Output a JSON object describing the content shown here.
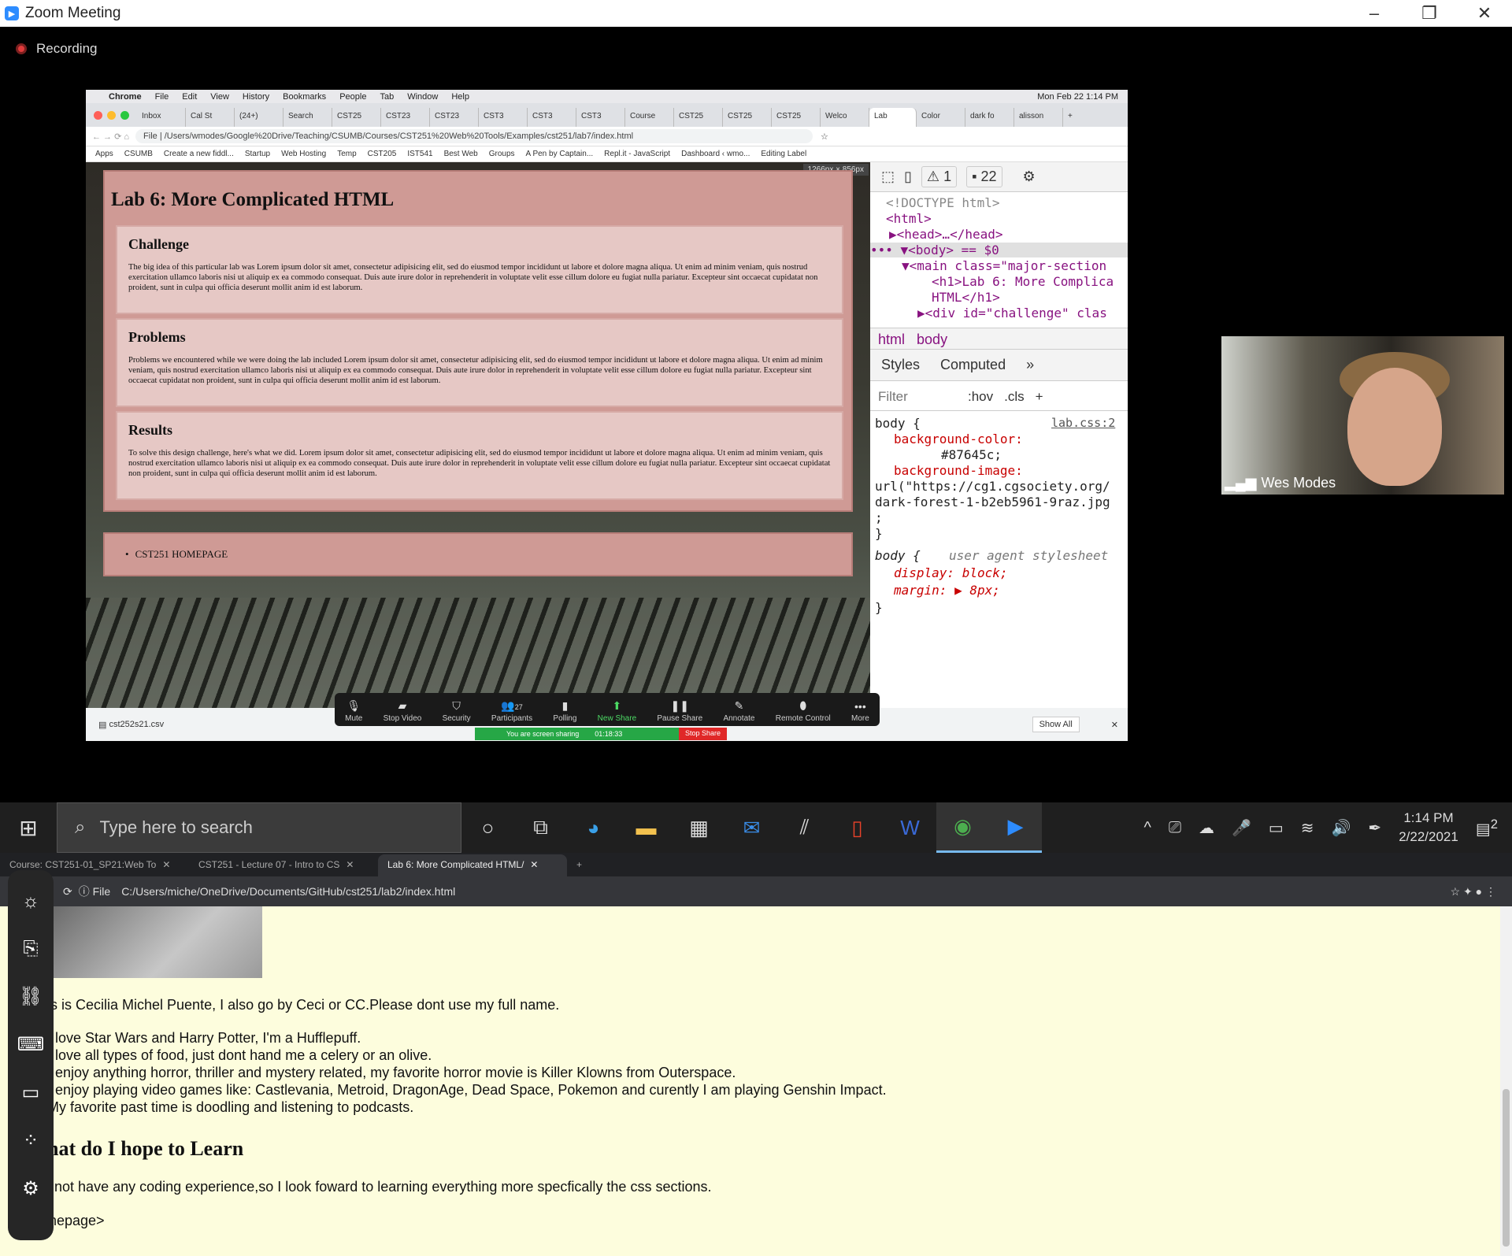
{
  "zoom": {
    "window_title": "Zoom Meeting",
    "recording_label": "Recording",
    "participant_name": "Wes Modes",
    "controls": [
      {
        "label": "Mute",
        "icon": "microphone-icon"
      },
      {
        "label": "Stop Video",
        "icon": "video-camera-icon"
      },
      {
        "label": "Security",
        "icon": "shield-icon"
      },
      {
        "label": "Participants",
        "icon": "participants-icon",
        "count": "27"
      },
      {
        "label": "Polling",
        "icon": "bar-chart-icon"
      },
      {
        "label": "New Share",
        "icon": "share-arrow-icon"
      },
      {
        "label": "Pause Share",
        "icon": "pause-icon"
      },
      {
        "label": "Annotate",
        "icon": "pencil-icon"
      },
      {
        "label": "Remote Control",
        "icon": "mouse-icon"
      },
      {
        "label": "More",
        "icon": "ellipsis-icon"
      }
    ],
    "sharing_text": "You are screen sharing",
    "sharing_time": "01:18:33",
    "stop_share": "Stop Share"
  },
  "mac": {
    "menubar": {
      "app": "Chrome",
      "items": [
        "File",
        "Edit",
        "View",
        "History",
        "Bookmarks",
        "People",
        "Tab",
        "Window",
        "Help"
      ],
      "datetime": "Mon Feb 22  1:14 PM"
    },
    "tabs": [
      "Inbox",
      "Cal St",
      "(24+)",
      "Search",
      "CST25",
      "CST23",
      "CST23",
      "CST3",
      "CST3",
      "CST3",
      "Course",
      "CST25",
      "CST25",
      "CST25",
      "Welco",
      "Lab",
      "Color",
      "dark fo",
      "alisson"
    ],
    "url": "/Users/wmodes/Google%20Drive/Teaching/CSUMB/Courses/CST251%20Web%20Tools/Examples/cst251/lab7/index.html",
    "url_scheme": "File",
    "bookmarks": [
      "Apps",
      "CSUMB",
      "Create a new fiddl...",
      "Startup",
      "Web Hosting",
      "Temp",
      "CST205",
      "IST541",
      "Best Web",
      "Groups",
      "A Pen by Captain...",
      "Repl.it - JavaScript",
      "Dashboard ‹ wmo...",
      "Editing Label"
    ],
    "viewport_size": "1266px × 856px",
    "lab_page": {
      "title": "Lab 6: More Complicated HTML",
      "sections": [
        {
          "heading": "Challenge",
          "text": "The big idea of this particular lab was Lorem ipsum dolor sit amet, consectetur adipisicing elit, sed do eiusmod tempor incididunt ut labore et dolore magna aliqua. Ut enim ad minim veniam, quis nostrud exercitation ullamco laboris nisi ut aliquip ex ea commodo consequat. Duis aute irure dolor in reprehenderit in voluptate velit esse cillum dolore eu fugiat nulla pariatur. Excepteur sint occaecat cupidatat non proident, sunt in culpa qui officia deserunt mollit anim id est laborum."
        },
        {
          "heading": "Problems",
          "text": "Problems we encountered while we were doing the lab included Lorem ipsum dolor sit amet, consectetur adipisicing elit, sed do eiusmod tempor incididunt ut labore et dolore magna aliqua. Ut enim ad minim veniam, quis nostrud exercitation ullamco laboris nisi ut aliquip ex ea commodo consequat. Duis aute irure dolor in reprehenderit in voluptate velit esse cillum dolore eu fugiat nulla pariatur. Excepteur sint occaecat cupidatat non proident, sunt in culpa qui officia deserunt mollit anim id est laborum."
        },
        {
          "heading": "Results",
          "text": "To solve this design challenge, here's what we did. Lorem ipsum dolor sit amet, consectetur adipisicing elit, sed do eiusmod tempor incididunt ut labore et dolore magna aliqua. Ut enim ad minim veniam, quis nostrud exercitation ullamco laboris nisi ut aliquip ex ea commodo consequat. Duis aute irure dolor in reprehenderit in voluptate velit esse cillum dolore eu fugiat nulla pariatur. Excepteur sint occaecat cupidatat non proident, sunt in culpa qui officia deserunt mollit anim id est laborum."
        }
      ],
      "nav_item": "CST251 HOMEPAGE"
    },
    "devtools": {
      "warnings": "1",
      "messages": "22",
      "dom_lines": [
        "<!DOCTYPE html>",
        "<html>",
        "▶<head>…</head>",
        "••• ▼<body> == $0",
        "▼<main class=\"major-section",
        "<h1>Lab 6: More Complica",
        "HTML</h1>",
        "▶<div id=\"challenge\" clas"
      ],
      "breadcrumb": [
        "html",
        "body"
      ],
      "panel_tabs": [
        "Styles",
        "Computed",
        "»"
      ],
      "filter_placeholder": "Filter",
      "hov": ":hov",
      "cls": ".cls",
      "style_lines": [
        "body {",
        "lab.css:2",
        "background-color:",
        "#87645c;",
        "background-image:",
        "url(\"https://cg1.cgsociety.org/",
        "dark-forest-1-b2eb5961-9raz.jpg",
        ";",
        "}",
        "body {",
        "user agent stylesheet",
        "display: block;",
        "margin: ▶ 8px;",
        "}"
      ]
    },
    "download_file": "cst252s21.csv",
    "show_all": "Show All"
  },
  "taskbar": {
    "search_placeholder": "Type here to search",
    "time": "1:14 PM",
    "date": "2/22/2021",
    "notifications": "2"
  },
  "bottom_browser": {
    "tabs": [
      "Course: CST251-01_SP21:Web To",
      "CST251 - Lecture 07 - Intro to CS",
      "Lab 6: More Complicated HTML/"
    ],
    "url_scheme": "File",
    "url": "C:/Users/miche/OneDrive/Documents/GitHub/cst251/lab2/index.html",
    "intro": "is is Cecilia Michel Puente, I also go by Ceci or CC.Please dont use my full name.",
    "list": [
      "I love Star Wars and Harry Potter, I'm a Hufflepuff.",
      "I love all types of food, just dont hand me a celery or an olive.",
      "I enjoy anything horror, thriller and mystery related, my favorite horror movie is Killer Klowns from Outerspace.",
      "I enjoy playing video games like: Castlevania, Metroid, DragonAge, Dead Space, Pokemon and curently I am playing Genshin Impact.",
      "My favorite past time is doodling and listening to podcasts."
    ],
    "heading": "What do I hope to Learn",
    "learn": "I do not have any coding experience,so I look foward to learning everything more specfically the css sections.",
    "homepage": "Homepage>"
  }
}
